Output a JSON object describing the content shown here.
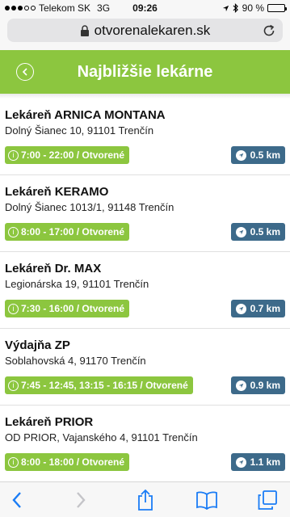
{
  "status_bar": {
    "carrier": "Telekom SK",
    "network": "3G",
    "time": "09:26",
    "battery": "90 %",
    "battery_level": 0.9
  },
  "browser": {
    "url": "otvorenalekaren.sk"
  },
  "header": {
    "title": "Najbližšie lekárne"
  },
  "pharmacies": [
    {
      "name": "Lekáreň ARNICA MONTANA",
      "address": "Dolný Šianec 10, 91101 Trenčín",
      "hours": "7:00 - 22:00 / Otvorené",
      "distance": "0.5 km"
    },
    {
      "name": "Lekáreň KERAMO",
      "address": "Dolný Šianec 1013/1, 91148 Trenčín",
      "hours": "8:00 - 17:00 / Otvorené",
      "distance": "0.5 km"
    },
    {
      "name": "Lekáreň Dr. MAX",
      "address": "Legionárska 19, 91101 Trenčín",
      "hours": "7:30 - 16:00 / Otvorené",
      "distance": "0.7 km"
    },
    {
      "name": "Výdajňa ZP",
      "address": "Soblahovská 4, 91170 Trenčín",
      "hours": "7:45 - 12:45, 13:15 - 16:15 / Otvorené",
      "distance": "0.9 km"
    },
    {
      "name": "Lekáreň PRIOR",
      "address": "OD PRIOR, Vajanského 4, 91101 Trenčín",
      "hours": "8:00 - 18:00 / Otvorené",
      "distance": "1.1 km"
    }
  ],
  "colors": {
    "accent_green": "#8cc63f",
    "distance_blue": "#3d6a8a",
    "ios_blue": "#1a7cf5"
  }
}
